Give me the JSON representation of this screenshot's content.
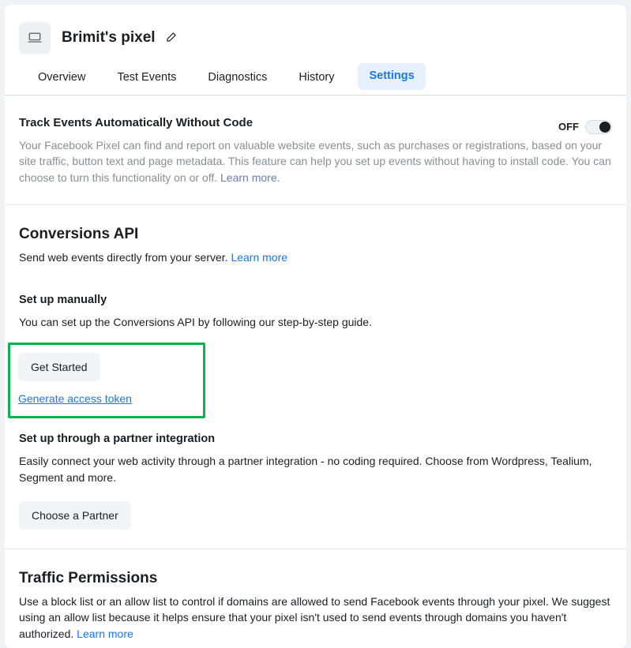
{
  "header": {
    "title": "Brimit's pixel"
  },
  "tabs": {
    "items": [
      "Overview",
      "Test Events",
      "Diagnostics",
      "History",
      "Settings"
    ],
    "activeIndex": 4
  },
  "track_events": {
    "heading": "Track Events Automatically Without Code",
    "toggle_label": "OFF",
    "toggle_state": "off",
    "description": "Your Facebook Pixel can find and report on valuable website events, such as purchases or registrations, based on your site traffic, button text and page metadata. This feature can help you set up events without having to install code. You can choose to turn this functionality on or off. ",
    "learn_more": "Learn more."
  },
  "conversions_api": {
    "heading": "Conversions API",
    "description": "Send web events directly from your server. ",
    "learn_more": "Learn more",
    "manual": {
      "heading": "Set up manually",
      "description": "You can set up the Conversions API by following our step-by-step guide.",
      "get_started_label": "Get Started",
      "generate_token_label": "Generate access token"
    },
    "partner": {
      "heading": "Set up through a partner integration",
      "description": "Easily connect your web activity through a partner integration - no coding required. Choose from Wordpress, Tealium, Segment and more.",
      "choose_partner_label": "Choose a Partner"
    }
  },
  "traffic_permissions": {
    "heading": "Traffic Permissions",
    "description": "Use a block list or an allow list to control if domains are allowed to send Facebook events through your pixel. We suggest using an allow list because it helps ensure that your pixel isn't used to send events through domains you haven't authorized. ",
    "learn_more": "Learn more"
  }
}
